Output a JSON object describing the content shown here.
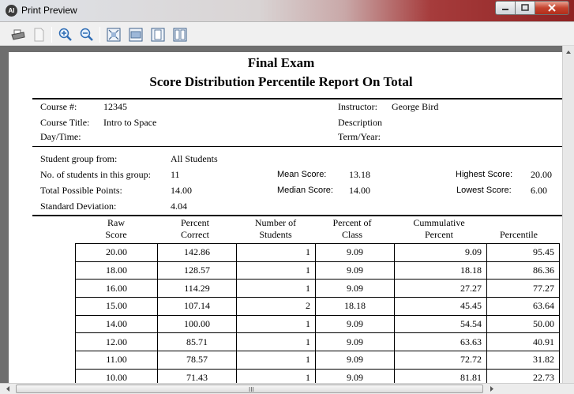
{
  "window": {
    "title": "Print Preview",
    "app_icon_text": "AI"
  },
  "toolbar": {
    "buttons": [
      "print-icon",
      "page-setup-icon",
      "zoom-in-icon",
      "zoom-out-icon",
      "fit-page-icon",
      "page-width-icon",
      "one-page-icon",
      "two-pages-icon"
    ]
  },
  "report": {
    "title": "Final Exam",
    "subtitle": "Score Distribution Percentile Report On Total",
    "course_num_label": "Course #:",
    "course_num": "12345",
    "course_title_label": "Course Title:",
    "course_title": "Intro to Space",
    "daytime_label": "Day/Time:",
    "instructor_label": "Instructor:",
    "instructor": "George Bird",
    "description_label": "Description",
    "term_label": "Term/Year:",
    "group_label": "Student group from:",
    "group": "All Students",
    "num_students_label": "No. of students in this group:",
    "num_students": "11",
    "possible_points_label": "Total Possible Points:",
    "possible_points": "14.00",
    "std_dev_label": "Standard Deviation:",
    "std_dev": "4.04",
    "mean_label": "Mean Score:",
    "mean": "13.18",
    "median_label": "Median Score:",
    "median": "14.00",
    "highest_label": "Highest Score:",
    "highest": "20.00",
    "lowest_label": "Lowest Score:",
    "lowest": "6.00"
  },
  "table": {
    "headers": [
      [
        "Raw",
        "Score"
      ],
      [
        "Percent",
        "Correct"
      ],
      [
        "Number of",
        "Students"
      ],
      [
        "Percent of",
        "Class"
      ],
      [
        "Cummulative",
        "Percent"
      ],
      [
        "",
        "Percentile"
      ]
    ],
    "rows": [
      [
        "20.00",
        "142.86",
        "1",
        "9.09",
        "9.09",
        "95.45"
      ],
      [
        "18.00",
        "128.57",
        "1",
        "9.09",
        "18.18",
        "86.36"
      ],
      [
        "16.00",
        "114.29",
        "1",
        "9.09",
        "27.27",
        "77.27"
      ],
      [
        "15.00",
        "107.14",
        "2",
        "18.18",
        "45.45",
        "63.64"
      ],
      [
        "14.00",
        "100.00",
        "1",
        "9.09",
        "54.54",
        "50.00"
      ],
      [
        "12.00",
        "85.71",
        "1",
        "9.09",
        "63.63",
        "40.91"
      ],
      [
        "11.00",
        "78.57",
        "1",
        "9.09",
        "72.72",
        "31.82"
      ],
      [
        "10.00",
        "71.43",
        "1",
        "9.09",
        "81.81",
        "22.73"
      ]
    ]
  },
  "scrollbar": {
    "grip": "III"
  }
}
